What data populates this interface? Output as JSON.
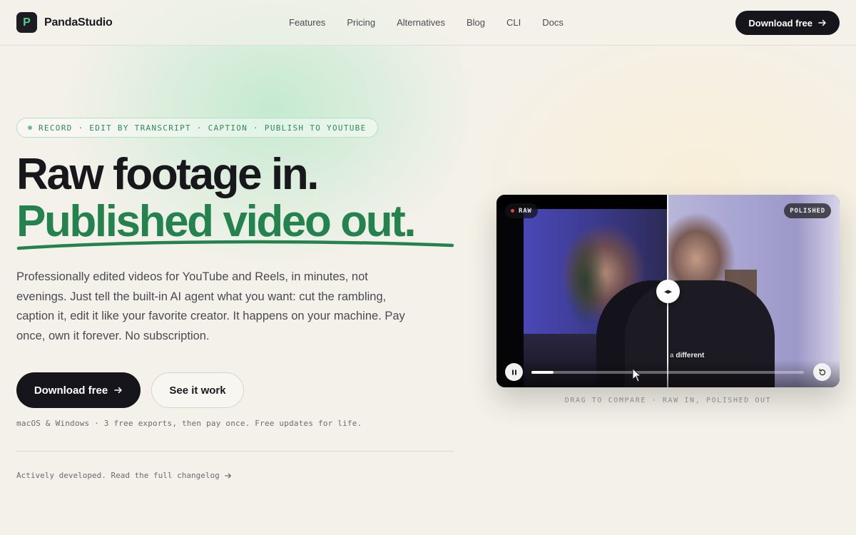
{
  "brand": {
    "logo_letter": "P",
    "name": "PandaStudio",
    "accent": "#24824f"
  },
  "nav": {
    "links": [
      "Features",
      "Pricing",
      "Alternatives",
      "Blog",
      "CLI",
      "Docs"
    ],
    "cta_label": "Download free"
  },
  "hero": {
    "pill_text": "RECORD · EDIT BY TRANSCRIPT · CAPTION · PUBLISH TO YOUTUBE",
    "headline_line1": "Raw footage in.",
    "headline_line2": "Published video out.",
    "description": "Professionally edited videos for YouTube and Reels, in minutes, not evenings. Just tell the built-in AI agent what you want: cut the rambling, caption it, edit it like your favorite creator. It happens on your machine. Pay once, own it forever. No subscription.",
    "primary_button": "Download free",
    "secondary_button": "See it work",
    "platform_note": "macOS & Windows · 3 free exports, then pay once. Free updates for life.",
    "changelog_link": "Actively developed. Read the full changelog"
  },
  "video": {
    "raw_badge": "RAW",
    "polished_badge": "POLISHED",
    "caption_prefix": "a",
    "caption_word": "different",
    "progress": 0.08,
    "compare_caption": "DRAG TO COMPARE · RAW IN, POLISHED OUT"
  },
  "icons": {
    "arrow": "arrow-right-icon",
    "pause": "pause-icon",
    "restart": "restart-icon",
    "split_handle": "drag-handle-icon"
  }
}
